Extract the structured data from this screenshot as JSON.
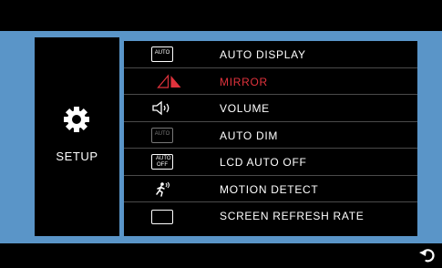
{
  "colors": {
    "frame": "#5a95c8",
    "selected": "#e0323c",
    "separator": "#4a4a4a"
  },
  "sidebar": {
    "icon": "gear-icon",
    "label": "SETUP"
  },
  "menu": {
    "items": [
      {
        "label": "AUTO DISPLAY",
        "icon": "auto-display-icon",
        "icon_text": "AUTO"
      },
      {
        "label": "MIRROR",
        "icon": "mirror-icon",
        "selected": true
      },
      {
        "label": "VOLUME",
        "icon": "speaker-icon"
      },
      {
        "label": "AUTO DIM",
        "icon": "auto-dim-icon",
        "icon_text": "AUTO"
      },
      {
        "label": "LCD AUTO OFF",
        "icon": "lcd-auto-off-icon",
        "icon_text": "AUTO OFF"
      },
      {
        "label": "MOTION DETECT",
        "icon": "motion-detect-icon"
      },
      {
        "label": "SCREEN REFRESH RATE",
        "icon": "screen-refresh-icon"
      }
    ]
  },
  "footer": {
    "icon": "back-icon"
  }
}
